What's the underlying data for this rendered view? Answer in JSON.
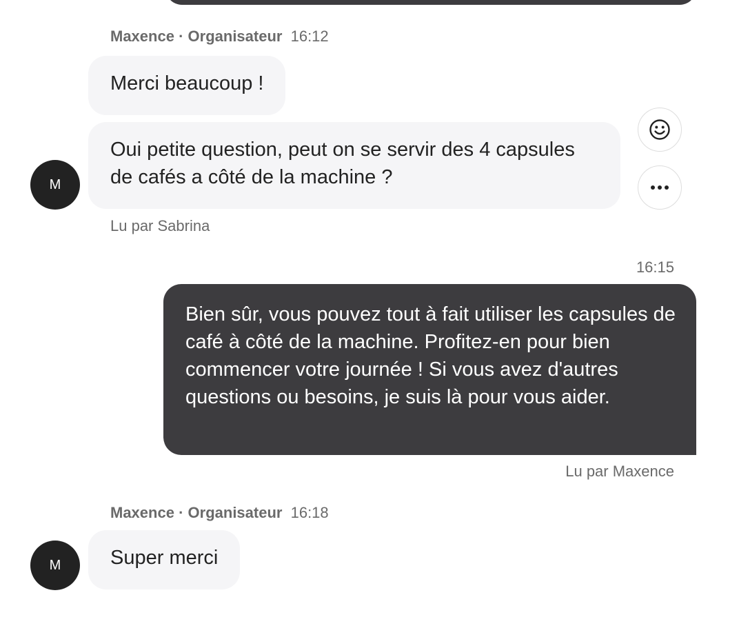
{
  "thread": {
    "messages": [
      {
        "sender": "Maxence",
        "role": "Organisateur",
        "separator": "·",
        "time": "16:12",
        "bubbles": [
          "Merci beaucoup !",
          "Oui petite question, peut on se servir des 4 capsules de cafés a côté de la machine ?"
        ],
        "avatar_initial": "M",
        "read_receipt": "Lu par Sabrina"
      },
      {
        "time": "16:15",
        "text": "Bien sûr, vous pouvez tout à fait utiliser les capsules de café à côté de la machine. Profitez-en pour bien commencer votre journée ! Si vous avez d'autres questions ou besoins, je suis là pour vous aider.",
        "read_receipt": "Lu par Maxence"
      },
      {
        "sender": "Maxence",
        "role": "Organisateur",
        "separator": "·",
        "time": "16:18",
        "text": "Super merci",
        "avatar_initial": "M"
      }
    ]
  },
  "actions": {
    "emoji_icon": "smiley-face-icon",
    "more_icon": "more-dots-icon"
  },
  "colors": {
    "outgoing_bubble": "#3d3c3f",
    "incoming_bubble": "#f5f5f7",
    "avatar": "#222222",
    "meta_text": "#6a6a6a"
  }
}
